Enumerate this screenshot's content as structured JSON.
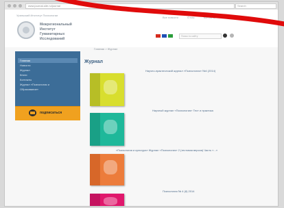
{
  "browser": {
    "url": "www.journal-site.ru/journal",
    "search_placeholder": "Search"
  },
  "site": {
    "institute_name": "Уральский Институт Психологии",
    "logo_lines": [
      "Межрегиональный",
      "Институт",
      "Гуманитарных",
      "Исследований"
    ],
    "top_links": [
      "Все новости",
      "О нас",
      "Контакты",
      "Карта сайта"
    ],
    "search_placeholder": "Поиск по сайту",
    "language_flags": [
      "#d52b1e",
      "#1f4fb4",
      "#2a9d3a"
    ]
  },
  "sidebar": {
    "items": [
      {
        "label": "Главная",
        "active": true
      },
      {
        "label": "Новости",
        "active": false
      },
      {
        "label": "Журнал",
        "active": false
      },
      {
        "label": "Книги",
        "active": false
      },
      {
        "label": "Контакты",
        "active": false
      },
      {
        "label": "Журнал «Психология и",
        "active": false
      },
      {
        "label": "Образование»",
        "active": false
      }
    ],
    "subscribe_label": "подписаться"
  },
  "main": {
    "breadcrumb": "Главная > Журнал",
    "title": "Журнал",
    "issues": [
      {
        "caption": "Научно-практический журнал «Психология» №4 (2014)",
        "color": "#d8de2e",
        "accent": "#a9b023"
      },
      {
        "caption": "Научный журнал «Психология» Тест и практика",
        "color": "#1fb89a",
        "accent": "#17967d"
      },
      {
        "caption": "«Психология и культура» Журнал «Психология» 2 (тестовая версия) Часть «...»",
        "color": "#ec7c3b",
        "accent": "#cf5e22"
      },
      {
        "caption": "Психология № 4 (8) 2014",
        "color": "#e0186c",
        "accent": "#b9105a"
      }
    ]
  }
}
